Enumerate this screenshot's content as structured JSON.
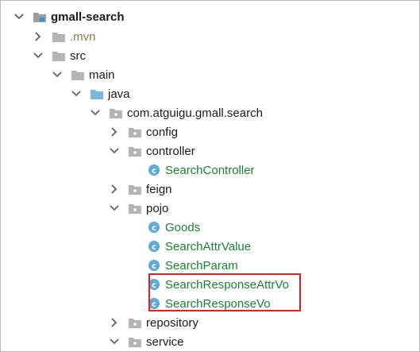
{
  "tree": {
    "rows": [
      {
        "label": "gmall-search",
        "kind": "module",
        "expanded": true
      },
      {
        "label": ".mvn",
        "kind": "folder",
        "expanded": false
      },
      {
        "label": "src",
        "kind": "folder",
        "expanded": true
      },
      {
        "label": "main",
        "kind": "folder",
        "expanded": true
      },
      {
        "label": "java",
        "kind": "source-root",
        "expanded": true
      },
      {
        "label": "com.atguigu.gmall.search",
        "kind": "package",
        "expanded": true
      },
      {
        "label": "config",
        "kind": "package",
        "expanded": false
      },
      {
        "label": "controller",
        "kind": "package",
        "expanded": true
      },
      {
        "label": "SearchController",
        "kind": "class"
      },
      {
        "label": "feign",
        "kind": "package",
        "expanded": false
      },
      {
        "label": "pojo",
        "kind": "package",
        "expanded": true
      },
      {
        "label": "Goods",
        "kind": "class"
      },
      {
        "label": "SearchAttrValue",
        "kind": "class"
      },
      {
        "label": "SearchParam",
        "kind": "class"
      },
      {
        "label": "SearchResponseAttrVo",
        "kind": "class"
      },
      {
        "label": "SearchResponseVo",
        "kind": "class"
      },
      {
        "label": "repository",
        "kind": "package",
        "expanded": false
      },
      {
        "label": "service",
        "kind": "package",
        "expanded": true
      }
    ]
  },
  "colors": {
    "class_text": "#1e7d34",
    "highlight_border": "#e02020",
    "folder": "#b4b4b4",
    "source_root": "#7ab8e0"
  },
  "icons": {
    "expanded": "chevron-down-icon",
    "collapsed": "chevron-right-icon",
    "folder": "folder-icon",
    "package": "package-icon",
    "class": "class-icon",
    "module": "module-icon"
  }
}
